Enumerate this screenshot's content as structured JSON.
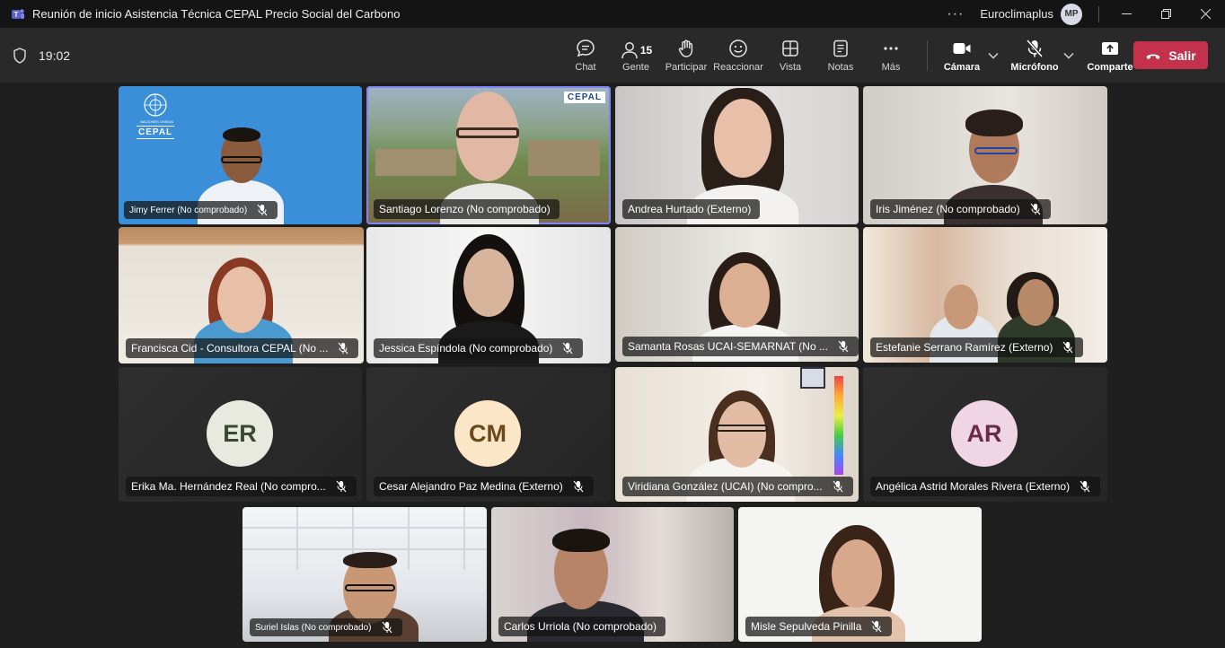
{
  "window": {
    "title": "Reunión de inicio Asistencia Técnica CEPAL Precio Social del Carbono",
    "org": "Euroclimaplus",
    "user_initials": "MP"
  },
  "toolbar": {
    "timer": "19:02",
    "people_count": "15",
    "chat": "Chat",
    "people": "Gente",
    "raise": "Participar",
    "react": "Reaccionar",
    "view": "Vista",
    "notes": "Notas",
    "more": "Más",
    "camera": "Cámara",
    "mic": "Micrófono",
    "share": "Comparte",
    "leave": "Salir"
  },
  "participants": [
    {
      "name": "Jimy Ferrer (No comprobado)"
    },
    {
      "name": "Santiago Lorenzo (No comprobado)"
    },
    {
      "name": "Andrea Hurtado (Externo)"
    },
    {
      "name": "Iris Jiménez (No comprobado)"
    },
    {
      "name": "Francisca Cid - Consultora CEPAL (No ..."
    },
    {
      "name": "Jessica Espíndola (No comprobado)"
    },
    {
      "name": "Samanta Rosas UCAI-SEMARNAT (No ..."
    },
    {
      "name": "Estefanie Serrano Ramírez (Externo)"
    },
    {
      "name": "Erika Ma. Hernández Real (No compro...",
      "initials": "ER"
    },
    {
      "name": "Cesar Alejandro Paz Medina (Externo)",
      "initials": "CM"
    },
    {
      "name": "Viridiana González (UCAI) (No compro..."
    },
    {
      "name": "Angélica Astrid Morales Rivera (Externo)",
      "initials": "AR"
    },
    {
      "name": "Suriel Islas (No comprobado)"
    },
    {
      "name": "Carlos Urriola (No comprobado)"
    },
    {
      "name": "Misle Sepulveda Pinilla"
    }
  ],
  "backgrounds": {
    "cepal_logo_text": "CEPAL",
    "un_text": "NACIONES UNIDAS"
  },
  "colors": {
    "leave_red": "#c4314b",
    "speaking_outline": "#7f85f5"
  }
}
